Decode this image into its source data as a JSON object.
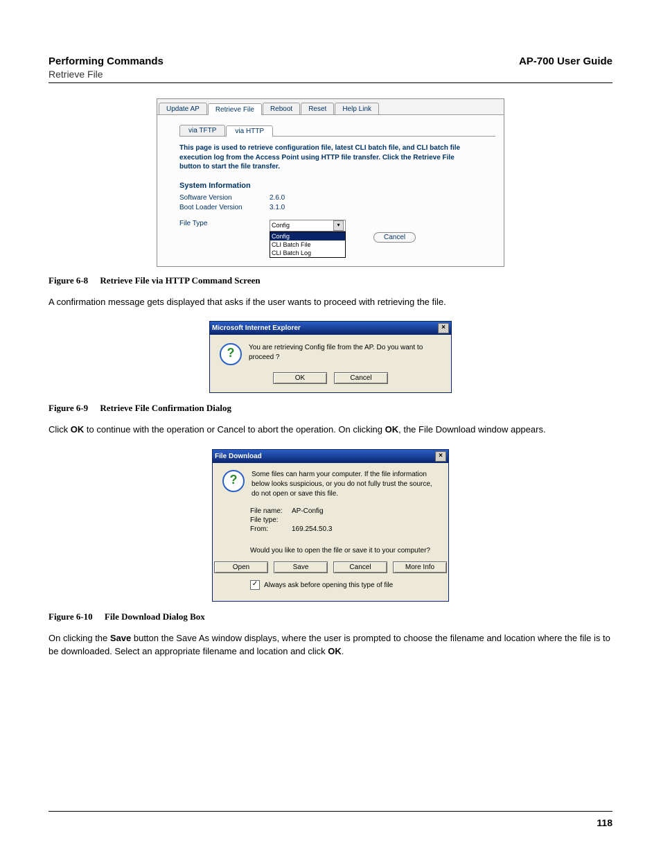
{
  "header": {
    "section": "Performing Commands",
    "subsection": "Retrieve File",
    "doc_title": "AP-700 User Guide"
  },
  "page_number": "118",
  "fig68": {
    "tabs": [
      "Update AP",
      "Retrieve File",
      "Reboot",
      "Reset",
      "Help Link"
    ],
    "active_tab": "Retrieve File",
    "subtabs": [
      "via TFTP",
      "via HTTP"
    ],
    "active_subtab": "via HTTP",
    "description": "This page is used to retrieve configuration file, latest CLI batch file, and CLI batch file execution log from the Access Point using HTTP file transfer. Click the Retrieve File button to start the file transfer.",
    "section_title": "System Information",
    "software_version_label": "Software Version",
    "software_version_value": "2.6.0",
    "bootloader_label": "Boot Loader Version",
    "bootloader_value": "3.1.0",
    "filetype_label": "File Type",
    "filetype_selected": "Config",
    "filetype_options": [
      "Config",
      "CLI Batch File",
      "CLI Batch Log"
    ],
    "cancel_label": "Cancel"
  },
  "caption68": {
    "num": "Figure 6-8",
    "title": "Retrieve File via HTTP Command Screen"
  },
  "para1": "A confirmation message gets displayed that asks if the user wants to proceed with retrieving the file.",
  "dlg69": {
    "title": "Microsoft Internet Explorer",
    "message": "You are retrieving Config file from the AP. Do you want to proceed ?",
    "ok": "OK",
    "cancel": "Cancel"
  },
  "caption69": {
    "num": "Figure 6-9",
    "title": "Retrieve File Confirmation Dialog"
  },
  "para2_pre": "Click ",
  "para2_ok1": "OK",
  "para2_mid": " to continue with the operation or Cancel to abort the operation. On clicking ",
  "para2_ok2": "OK",
  "para2_post": ", the File Download window appears.",
  "dlg610": {
    "title": "File Download",
    "warning": "Some files can harm your computer. If the file information below looks suspicious, or you do not fully trust the source, do not open or save this file.",
    "filename_label": "File name:",
    "filename_value": "AP-Config",
    "filetype_label": "File type:",
    "filetype_value": "",
    "from_label": "From:",
    "from_value": "169.254.50.3",
    "prompt": "Would you like to open the file or save it to your computer?",
    "open": "Open",
    "save": "Save",
    "cancel": "Cancel",
    "moreinfo": "More Info",
    "checkbox_label": "Always ask before opening this type of file"
  },
  "caption610": {
    "num": "Figure 6-10",
    "title": "File Download Dialog Box"
  },
  "para3_pre": "On clicking the ",
  "para3_save": "Save",
  "para3_mid": " button the Save As window displays, where the user is prompted to choose the filename and location where the file is to be downloaded. Select an appropriate filename and location and click ",
  "para3_ok": "OK",
  "para3_post": "."
}
